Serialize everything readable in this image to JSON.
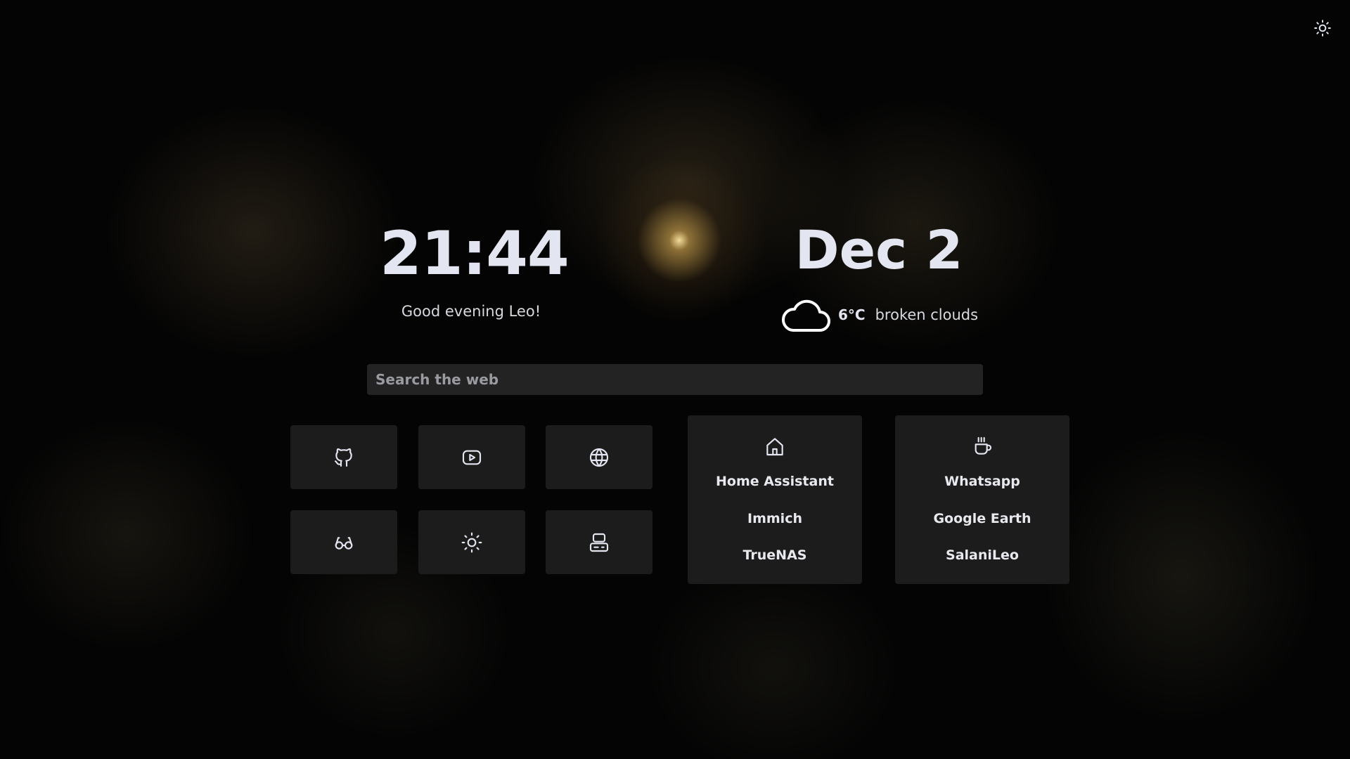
{
  "clock": {
    "time": "21:44",
    "greeting": "Good evening Leo!"
  },
  "date": {
    "label": "Dec 2"
  },
  "weather": {
    "icon": "cloud-icon",
    "temperature": "6°C",
    "description": "broken clouds"
  },
  "search": {
    "placeholder": "Search the web",
    "value": ""
  },
  "quick_links": [
    {
      "icon": "github-icon"
    },
    {
      "icon": "youtube-icon"
    },
    {
      "icon": "globe-icon"
    },
    {
      "icon": "glasses-icon"
    },
    {
      "icon": "sun-icon"
    },
    {
      "icon": "server-icon"
    }
  ],
  "panels": [
    {
      "icon": "home-icon",
      "links": [
        "Home Assistant",
        "Immich",
        "TrueNAS"
      ]
    },
    {
      "icon": "coffee-icon",
      "links": [
        "Whatsapp",
        "Google Earth",
        "SalaniLeo"
      ]
    }
  ],
  "theme_toggle": {
    "icon": "sun-icon"
  },
  "colors": {
    "text": "#e3e6f0",
    "tile_bg": "#1e1e1e",
    "background": "#040404"
  }
}
